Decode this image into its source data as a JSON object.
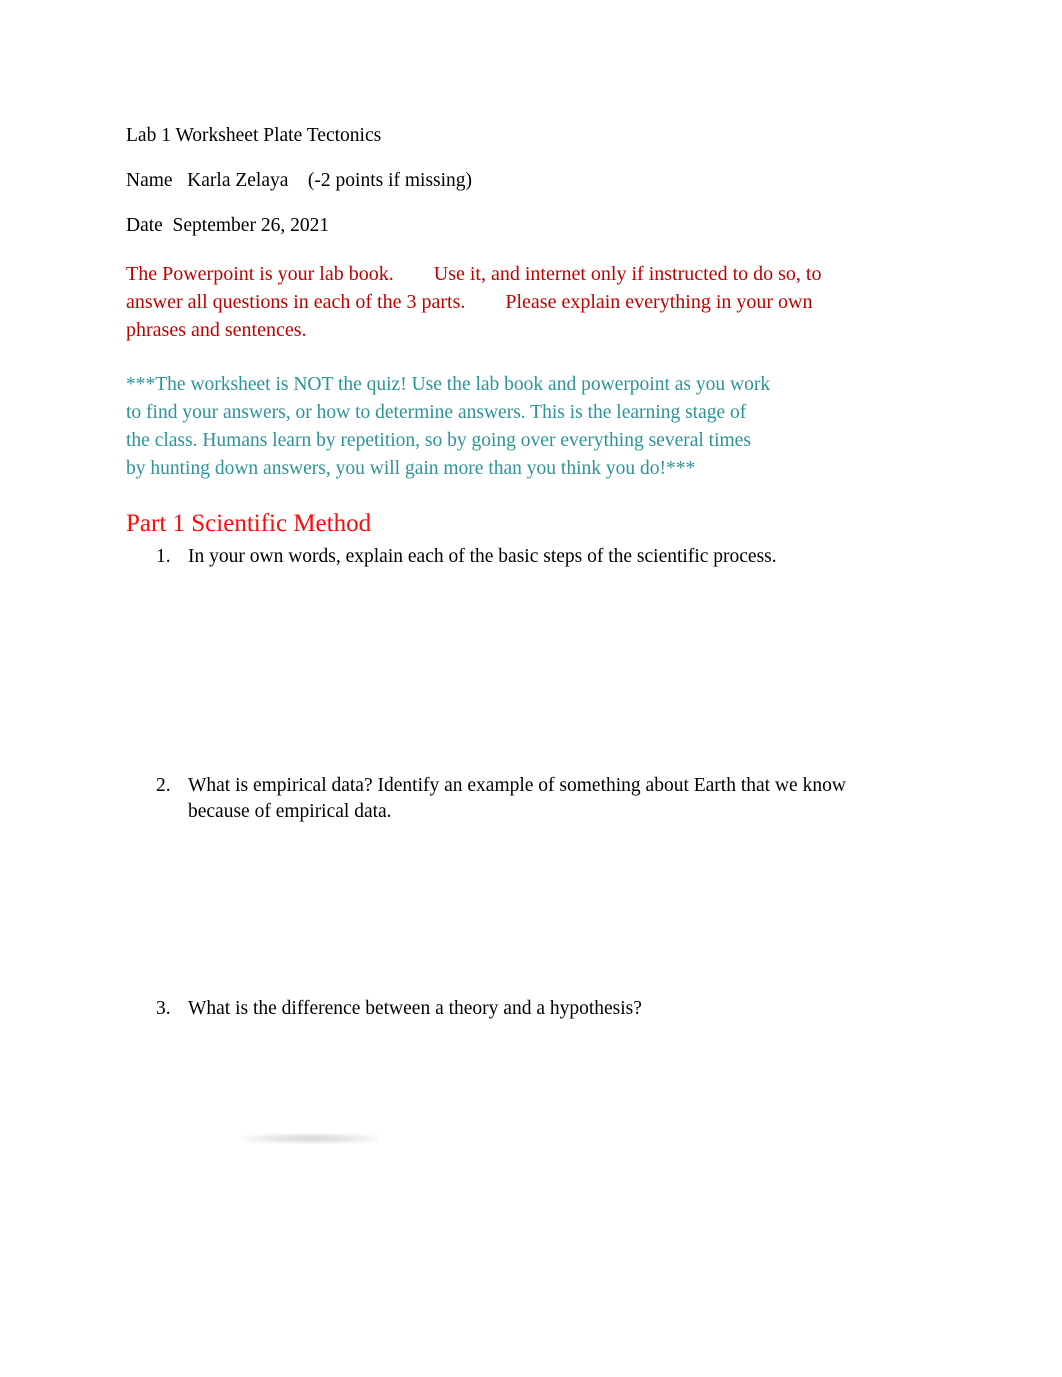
{
  "document": {
    "title": "Lab 1 Worksheet Plate Tectonics",
    "background_color": "#ffffff",
    "text_color": "#000000"
  },
  "header": {
    "title_line": "Lab 1 Worksheet Plate Tectonics",
    "name_line": "Name   Karla Zelaya    (-2 points if missing)",
    "date_line": "Date  September 26, 2021"
  },
  "instructions": {
    "red_color": "#c00000",
    "red_paragraph": "The Powerpoint is your lab book.        Use it, and internet only if instructed to do so, to answer all questions in each of the 3 parts.        Please explain everything in your own phrases and sentences.",
    "teal_color": "#2e9299",
    "teal_lines": [
      "***The worksheet is NOT the quiz! Use the lab book and powerpoint as you work",
      "to find your answers, or how to determine answers. This is the learning stage of",
      "the class. Humans learn by repetition, so by going over everything several times",
      "by hunting down answers, you will gain more than you think you do!***"
    ]
  },
  "part1": {
    "heading": "Part 1 Scientific Method",
    "heading_color": "#fb0b0b",
    "questions": [
      {
        "number": "1.",
        "text": "In your own words, explain each of the basic steps of the scientific process."
      },
      {
        "number": "2.",
        "text": "What is empirical data? Identify an example of something about Earth that we know because of empirical data."
      },
      {
        "number": "3.",
        "text": "What is the difference between a theory and a hypothesis?"
      }
    ]
  }
}
